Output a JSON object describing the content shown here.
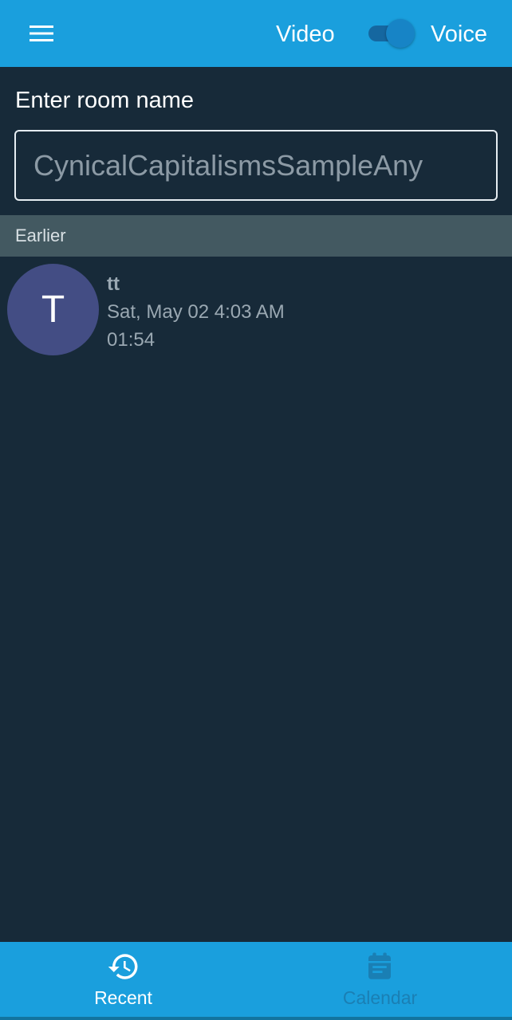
{
  "header": {
    "menu_icon": "hamburger-menu-icon",
    "video_label": "Video",
    "voice_label": "Voice",
    "toggle_state": "on"
  },
  "room": {
    "label": "Enter room name",
    "value": "CynicalCapitalismsSampleAny"
  },
  "recent": {
    "section_title": "Earlier",
    "items": [
      {
        "avatar_letter": "T",
        "title": "tt",
        "date": "Sat, May 02 4:03 AM",
        "duration": "01:54"
      }
    ]
  },
  "bottom_nav": {
    "items": [
      {
        "label": "Recent",
        "icon": "history-icon",
        "active": true
      },
      {
        "label": "Calendar",
        "icon": "calendar-icon",
        "active": false
      }
    ]
  },
  "colors": {
    "accent": "#1a9fdd",
    "background": "#172a39",
    "section_header": "#435961",
    "avatar": "#434d84"
  }
}
